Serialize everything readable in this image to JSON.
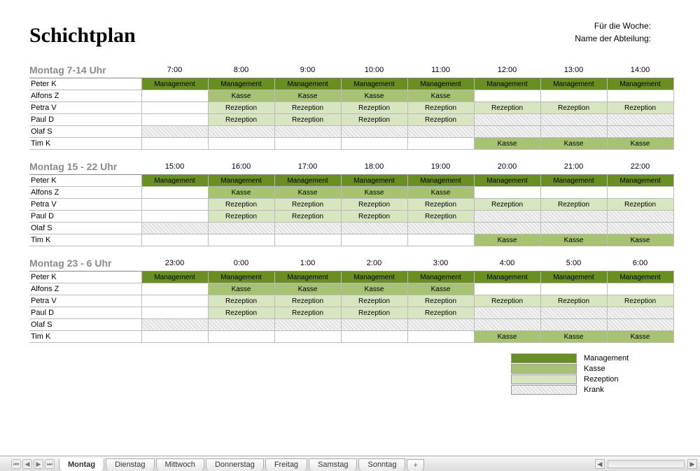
{
  "title": "Schichtplan",
  "meta": {
    "week_label": "Für die Woche:",
    "dept_label": "Name der Abteilung:"
  },
  "hours_sets": [
    {
      "heading": "Montag 7-14 Uhr",
      "hours": [
        "7:00",
        "8:00",
        "9:00",
        "10:00",
        "11:00",
        "12:00",
        "13:00",
        "14:00"
      ]
    },
    {
      "heading": "Montag 15 - 22 Uhr",
      "hours": [
        "15:00",
        "16:00",
        "17:00",
        "18:00",
        "19:00",
        "20:00",
        "21:00",
        "22:00"
      ]
    },
    {
      "heading": "Montag 23 - 6 Uhr",
      "hours": [
        "23:00",
        "0:00",
        "1:00",
        "2:00",
        "3:00",
        "4:00",
        "5:00",
        "6:00"
      ]
    }
  ],
  "employees": [
    "Peter K",
    "Alfons Z",
    "Petra V",
    "Paul D",
    "Olaf S",
    "Tim K"
  ],
  "assignments": [
    [
      "Management",
      "Management",
      "Management",
      "Management",
      "Management",
      "Management",
      "Management",
      "Management"
    ],
    [
      "",
      "Kasse",
      "Kasse",
      "Kasse",
      "Kasse",
      "",
      "",
      ""
    ],
    [
      "",
      "Rezeption",
      "Rezeption",
      "Rezeption",
      "Rezeption",
      "Rezeption",
      "Rezeption",
      "Rezeption"
    ],
    [
      "",
      "Rezeption",
      "Rezeption",
      "Rezeption",
      "Rezeption",
      "Krank",
      "Krank",
      "Krank"
    ],
    [
      "Krank",
      "Krank",
      "Krank",
      "Krank",
      "Krank",
      "Krank",
      "Krank",
      "Krank"
    ],
    [
      "",
      "",
      "",
      "",
      "",
      "Kasse",
      "Kasse",
      "Kasse"
    ]
  ],
  "legend": [
    {
      "label": "Management",
      "class": "c-management"
    },
    {
      "label": "Kasse",
      "class": "c-kasse"
    },
    {
      "label": "Rezeption",
      "class": "c-rezeption"
    },
    {
      "label": "Krank",
      "class": "c-krank"
    }
  ],
  "tabs": [
    "Montag",
    "Dienstag",
    "Mittwoch",
    "Donnerstag",
    "Freitag",
    "Samstag",
    "Sonntag"
  ],
  "active_tab": 0,
  "chart_data": {
    "type": "table",
    "title": "Schichtplan",
    "day": "Montag",
    "time_blocks": [
      {
        "label": "Montag 7-14 Uhr",
        "hours": [
          "7:00",
          "8:00",
          "9:00",
          "10:00",
          "11:00",
          "12:00",
          "13:00",
          "14:00"
        ]
      },
      {
        "label": "Montag 15 - 22 Uhr",
        "hours": [
          "15:00",
          "16:00",
          "17:00",
          "18:00",
          "19:00",
          "20:00",
          "21:00",
          "22:00"
        ]
      },
      {
        "label": "Montag 23 - 6 Uhr",
        "hours": [
          "23:00",
          "0:00",
          "1:00",
          "2:00",
          "3:00",
          "4:00",
          "5:00",
          "6:00"
        ]
      }
    ],
    "employees": [
      "Peter K",
      "Alfons Z",
      "Petra V",
      "Paul D",
      "Olaf S",
      "Tim K"
    ],
    "cell_values_per_block": [
      [
        "Management",
        "Management",
        "Management",
        "Management",
        "Management",
        "Management",
        "Management",
        "Management"
      ],
      [
        "",
        "Kasse",
        "Kasse",
        "Kasse",
        "Kasse",
        "",
        "",
        ""
      ],
      [
        "",
        "Rezeption",
        "Rezeption",
        "Rezeption",
        "Rezeption",
        "Rezeption",
        "Rezeption",
        "Rezeption"
      ],
      [
        "",
        "Rezeption",
        "Rezeption",
        "Rezeption",
        "Rezeption",
        "Krank",
        "Krank",
        "Krank"
      ],
      [
        "Krank",
        "Krank",
        "Krank",
        "Krank",
        "Krank",
        "Krank",
        "Krank",
        "Krank"
      ],
      [
        "",
        "",
        "",
        "",
        "",
        "Kasse",
        "Kasse",
        "Kasse"
      ]
    ],
    "legend_categories": [
      "Management",
      "Kasse",
      "Rezeption",
      "Krank"
    ],
    "note": "All three time blocks repeat identical assignment patterns in the screenshot."
  }
}
